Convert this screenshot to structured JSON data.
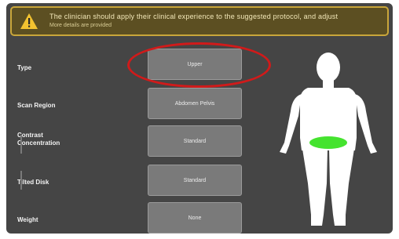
{
  "banner": {
    "icon": "warning-icon",
    "line1": "The clinician should apply their clinical experience to the suggested protocol, and adjust",
    "line2": "More details are provided",
    "colors": {
      "background": "#5c4f22",
      "border": "#c9a63a",
      "icon": "#f2c230"
    }
  },
  "form": {
    "fields": [
      {
        "label": "Type",
        "value": "Upper"
      },
      {
        "label": "Scan Region",
        "value": "Abdomen Pelvis"
      },
      {
        "label": "Contrast Concentration",
        "value": "Standard"
      },
      {
        "label": "Tilted Disk",
        "value": "Standard"
      },
      {
        "label": "Weight",
        "value": "None"
      }
    ]
  },
  "annotation": {
    "color": "#d11a1a",
    "target": "Type"
  },
  "body_diagram": {
    "body_color": "#ffffff",
    "highlight_region": "pelvis",
    "highlight_color": "#45e32f"
  }
}
